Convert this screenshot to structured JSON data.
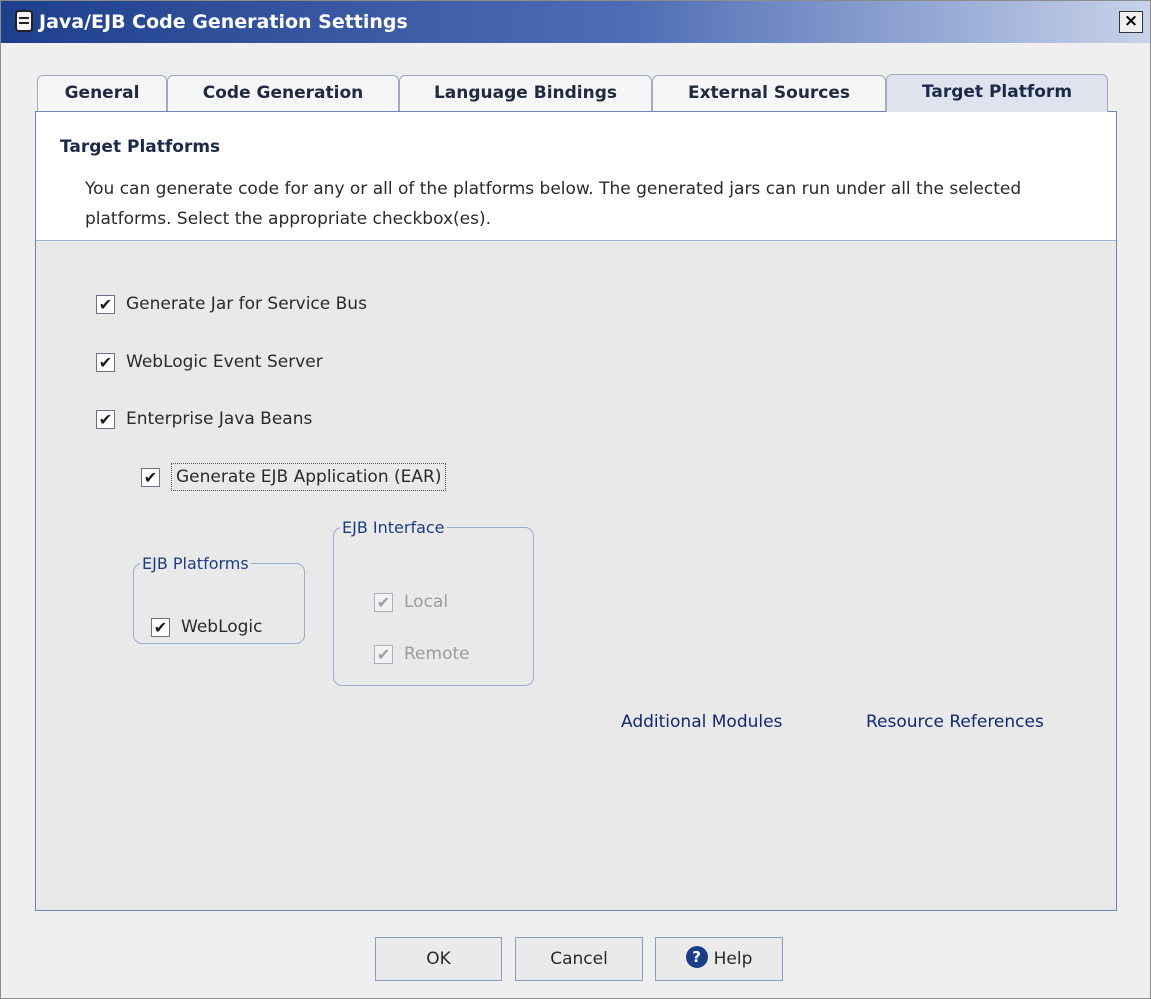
{
  "window": {
    "title": "Java/EJB Code Generation Settings",
    "close_symbol": "×"
  },
  "tabs": [
    {
      "label": "General"
    },
    {
      "label": "Code Generation"
    },
    {
      "label": "Language Bindings"
    },
    {
      "label": "External Sources"
    },
    {
      "label": "Target Platform"
    }
  ],
  "header": {
    "title": "Target Platforms",
    "description": "You can generate code for any or all of the platforms below. The generated jars can run under all the selected platforms. Select the appropriate checkbox(es)."
  },
  "options": {
    "service_bus": {
      "label": "Generate Jar for Service Bus",
      "checked": true
    },
    "event_server": {
      "label": "WebLogic Event Server",
      "checked": true
    },
    "ejb": {
      "label": "Enterprise Java Beans",
      "checked": true
    },
    "ear": {
      "label": "Generate EJB Application (EAR)",
      "checked": true
    }
  },
  "ejb_platforms": {
    "legend": "EJB Platforms",
    "weblogic": {
      "label": "WebLogic",
      "checked": true
    }
  },
  "ejb_interface": {
    "legend": "EJB Interface",
    "local": {
      "label": "Local",
      "checked": true,
      "disabled": true
    },
    "remote": {
      "label": "Remote",
      "checked": true,
      "disabled": true
    }
  },
  "links": {
    "additional_modules": "Additional Modules",
    "resource_references": "Resource References"
  },
  "buttons": {
    "ok": "OK",
    "cancel": "Cancel",
    "help": "Help",
    "help_glyph": "?"
  },
  "check_glyph": "✔",
  "colors": {
    "title_gradient_start": "#1e3f8c",
    "accent": "#1e3e84",
    "panel_border": "#6f86b8"
  }
}
